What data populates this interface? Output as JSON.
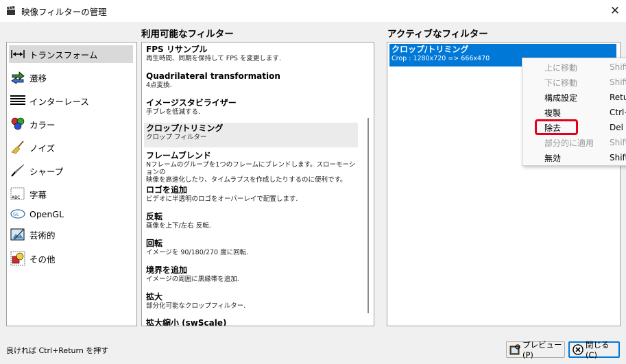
{
  "window": {
    "title": "映像フィルターの管理",
    "app_icon": "clapperboard-icon"
  },
  "headings": {
    "available": "利用可能なフィルター",
    "active": "アクティブなフィルター"
  },
  "categories": [
    {
      "label": "トランスフォーム",
      "icon": "transform-arrows-icon",
      "selected": true
    },
    {
      "label": "遷移",
      "icon": "transition-arrows-icon"
    },
    {
      "label": "インターレース",
      "icon": "interlace-lines-icon"
    },
    {
      "label": "カラー",
      "icon": "color-circles-icon"
    },
    {
      "label": "ノイズ",
      "icon": "broom-icon"
    },
    {
      "label": "シャープ",
      "icon": "knife-icon"
    },
    {
      "label": "字幕",
      "icon": "subtitle-icon"
    },
    {
      "label": "OpenGL",
      "icon": "opengl-logo-icon"
    },
    {
      "label": "芸術的",
      "icon": "painting-icon"
    },
    {
      "label": "その他",
      "icon": "misc-icon"
    }
  ],
  "filters": [
    {
      "name": "FPS リサンプル",
      "desc": "再生時間、同期を保持して FPS を変更します."
    },
    {
      "name": "Quadrilateral transformation",
      "desc": "4点変換."
    },
    {
      "name": "イメージスタビライザー",
      "desc": "手ブレを低減する."
    },
    {
      "name": "クロップ/トリミング",
      "desc": "クロップ フィルター",
      "selected": true
    },
    {
      "name": "フレームブレンド",
      "desc": "Nフレームのグループを1つのフレームにブレンドします。スローモーションの",
      "desc2": "映像を高速化したり、タイムラプスを作成したりするのに便利です。"
    },
    {
      "name": "ロゴを追加",
      "desc": "ビデオに半透明のロゴをオーバーレイで配置します."
    },
    {
      "name": "反転",
      "desc": "画像を上下/左右 反転."
    },
    {
      "name": "回転",
      "desc": "イメージを 90/180/270 度に回転."
    },
    {
      "name": "境界を追加",
      "desc": "イメージの周囲に黒縁帯を追加."
    },
    {
      "name": "拡大",
      "desc": "部分化可能なクロップフィルター."
    },
    {
      "name": "拡大縮小 (swScale)",
      "desc": ""
    }
  ],
  "active_filters": [
    {
      "name": "クロップ/トリミング",
      "desc": "Crop : 1280x720 => 666x470"
    }
  ],
  "context_menu": [
    {
      "label": "上に移動",
      "shortcut": "Shift",
      "disabled": true
    },
    {
      "label": "下に移動",
      "shortcut": "Shift",
      "disabled": true
    },
    {
      "label": "構成設定",
      "shortcut": "Retu"
    },
    {
      "label": "複製",
      "shortcut": "Ctrl+"
    },
    {
      "label": "除去",
      "shortcut": "Del",
      "highlighted": true
    },
    {
      "label": "部分的に適用",
      "shortcut": "Shift",
      "disabled": true
    },
    {
      "label": "無効",
      "shortcut": "Shift"
    }
  ],
  "status": {
    "hint": "良ければ Ctrl+Return を押す"
  },
  "buttons": {
    "preview": "プレビュー(P)",
    "close": "閉じる(C)"
  },
  "colors": {
    "selection": "#0078d7",
    "highlight_box": "#e3001b"
  }
}
